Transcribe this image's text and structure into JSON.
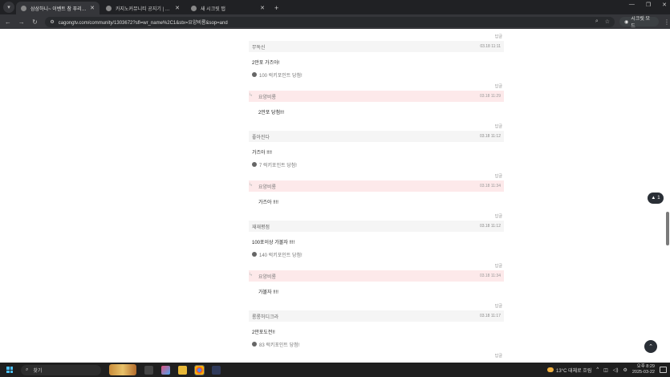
{
  "browser": {
    "tabs": [
      {
        "title": "삼삼하니~ 이벤트 참 푸리겠습",
        "active": true
      },
      {
        "title": "카지노커뮤니티 공지기 | 카지",
        "active": false
      },
      {
        "title": "새 시크릿 탭",
        "active": false
      }
    ],
    "url": "cagongtv.com/community/1303672?sfl=wr_name%2C1&stx=요양비룡&sop=and",
    "secret_label": "시크릿 모드"
  },
  "comments": [
    {
      "author": "무독신",
      "datetime": "03.18 11:11",
      "body": "2만포 가즈아!",
      "points": "100 럭키포인트 당첨!",
      "reply": {
        "author": "요양비룡",
        "datetime": "03.18 11:29",
        "body": "2만포 당첨!!!"
      }
    },
    {
      "author": "좋아진다",
      "datetime": "03.18 11:12",
      "body": "가즈아 !!!!",
      "points": "7 럭키포인트 당첨!",
      "reply": {
        "author": "요양비룡",
        "datetime": "03.18 11:34",
        "body": "가즈아 !!!!"
      }
    },
    {
      "author": "재재평점",
      "datetime": "03.18 11:12",
      "body": "100포이상 가볼자 !!!!",
      "points": "140 럭키포인트 당첨!",
      "reply": {
        "author": "요양비룡",
        "datetime": "03.18 11:34",
        "body": "가볼자 !!!!"
      }
    },
    {
      "author": "롱롱허디크라",
      "datetime": "03.18 11:17",
      "body": "2만포도전!!",
      "points": "83 럭키포인트 당첨!"
    }
  ],
  "reply_label": "답글",
  "badge_count": "1",
  "taskbar": {
    "search_placeholder": "찾기",
    "weather": "13°C 대체로 흐림",
    "time": "오후 8:29",
    "date": "2025-03-22"
  }
}
